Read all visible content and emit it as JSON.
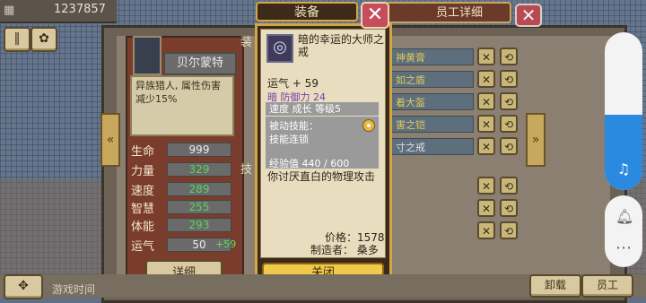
{
  "top": {
    "money": "1237857",
    "icons": [
      "money-icon",
      "pause-icon",
      "settings-icon"
    ]
  },
  "staff": {
    "tab_title": "员工详细",
    "name": "贝尔蒙特",
    "description": "异族猎人, 属性伤害减少15%",
    "stats": [
      {
        "label": "生命",
        "value": "999",
        "bonus": "",
        "color": "white"
      },
      {
        "label": "力量",
        "value": "329",
        "bonus": "",
        "color": "green"
      },
      {
        "label": "速度",
        "value": "289",
        "bonus": "",
        "color": "green"
      },
      {
        "label": "智慧",
        "value": "255",
        "bonus": "",
        "color": "green"
      },
      {
        "label": "体能",
        "value": "293",
        "bonus": "",
        "color": "green"
      },
      {
        "label": "运气",
        "value": "50",
        "bonus": "+59",
        "color": "white"
      }
    ],
    "detail_button": "详细",
    "right_col_labels": [
      "装",
      "技"
    ],
    "equip_rows": [
      "神黄膏",
      "如之盾",
      "着大盔",
      "害之铠",
      "寸之戒"
    ]
  },
  "popup": {
    "title": "装备",
    "item_name": "暗的幸运的大师之戒",
    "luck": "运气 + 59",
    "element_defense": "暗 防御力 24",
    "band": "速度 成长 等级5",
    "passive_label": "被动技能：",
    "passive_skill": "技能连锁",
    "exp": "经验值 440 / 600",
    "flavor": "你讨厌直白的物理攻击",
    "price": "价格：1578",
    "maker": "制造者： 桑多",
    "close_button": "关闭"
  },
  "bottom": {
    "left_text": "游戏时间",
    "right_buttons": [
      "卸载",
      "员工"
    ]
  },
  "system": {
    "volume_level": 0.48
  }
}
